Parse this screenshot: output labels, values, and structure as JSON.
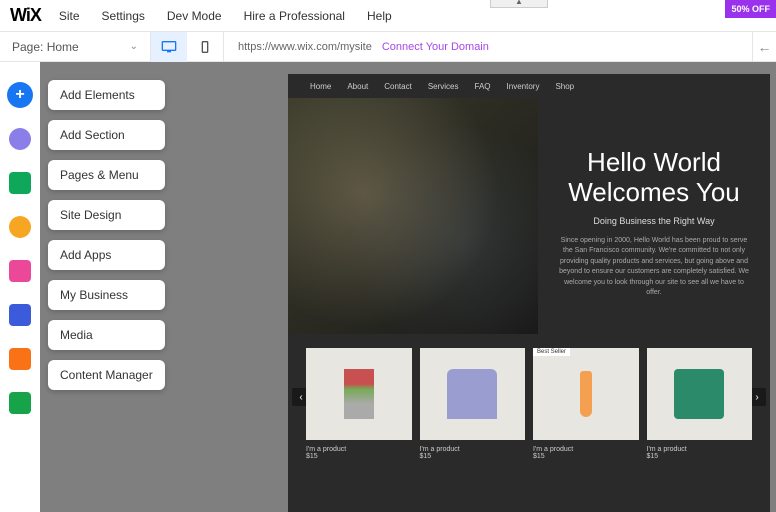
{
  "top": {
    "logo": "WiX",
    "menu": [
      "Site",
      "Settings",
      "Dev Mode",
      "Hire a Professional",
      "Help"
    ],
    "promo": "50% OFF",
    "toggle_glyph": "▲"
  },
  "subbar": {
    "page_label": "Page: Home",
    "url": "https://www.wix.com/mysite",
    "connect": "Connect Your Domain"
  },
  "floating": [
    "Add Elements",
    "Add Section",
    "Pages & Menu",
    "Site Design",
    "Add Apps",
    "My Business",
    "Media",
    "Content Manager"
  ],
  "leftbar_colors": [
    "#1976f2",
    "#8a7fe8",
    "#0fa85a",
    "#f6a623",
    "#ec4899",
    "#3b5bdb",
    "#f97316",
    "#16a34a"
  ],
  "preview": {
    "nav": [
      "Home",
      "About",
      "Contact",
      "Services",
      "FAQ",
      "Inventory",
      "Shop"
    ],
    "hero": {
      "title_l1": "Hello World",
      "title_l2": "Welcomes You",
      "sub": "Doing Business the Right Way",
      "para": "Since opening in 2000, Hello World has been proud to serve the San Francisco community. We're committed to not only providing quality products and services, but going above and beyond to ensure our customers are completely satisfied. We welcome you to look through our site to see all we have to offer."
    },
    "products": [
      {
        "label": "I'm a product",
        "price": "$15"
      },
      {
        "label": "I'm a product",
        "price": "$15"
      },
      {
        "label": "I'm a product",
        "price": "$15",
        "badge": "Best Seller"
      },
      {
        "label": "I'm a product",
        "price": "$15"
      }
    ]
  }
}
